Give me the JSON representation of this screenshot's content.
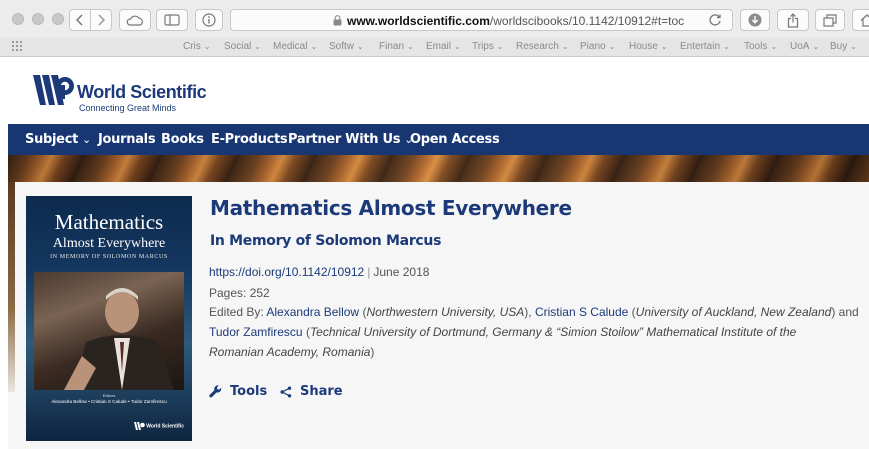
{
  "browser": {
    "url_domain": "www.worldscientific.com",
    "url_path": "/worldscibooks/10.1142/10912#t=toc",
    "favorites": [
      {
        "label": "Cris"
      },
      {
        "label": "Social"
      },
      {
        "label": "Medical"
      },
      {
        "label": "Softw"
      },
      {
        "label": "Finan"
      },
      {
        "label": "Email"
      },
      {
        "label": "Trips"
      },
      {
        "label": "Research"
      },
      {
        "label": "Piano"
      },
      {
        "label": "House"
      },
      {
        "label": "Entertain"
      },
      {
        "label": "Tools"
      },
      {
        "label": "UoA"
      },
      {
        "label": "Buy"
      }
    ],
    "favorites_chevron": "⌄"
  },
  "site": {
    "logo_title": "World Scientific",
    "logo_tagline": "Connecting Great Minds",
    "brand_color": "#1c3a7a",
    "nav": [
      {
        "label": "Subject",
        "has_dropdown": true
      },
      {
        "label": "Journals"
      },
      {
        "label": "Books"
      },
      {
        "label": "E-Products"
      },
      {
        "label": "Partner With Us",
        "has_dropdown": true
      },
      {
        "label": "Open Access"
      }
    ],
    "nav_chevron": "⌄"
  },
  "book": {
    "cover": {
      "title_line1": "Mathematics",
      "title_line2": "Almost Everywhere",
      "subtitle": "In Memory of Solomon Marcus",
      "editors_label": "Editors",
      "editors": "Alexandra Bellow • Cristian S Calude • Tudor Zamfirescu",
      "publisher": "World Scientific"
    },
    "title": "Mathematics Almost Everywhere",
    "subtitle": "In Memory of Solomon Marcus",
    "doi": "https://doi.org/10.1142/10912",
    "date": "June 2018",
    "separator": "|",
    "pages": "Pages: 252",
    "edited_by_label": "Edited By:",
    "editor1_name": "Alexandra Bellow",
    "editor1_aff": "Northwestern University, USA",
    "editor2_name": "Cristian S Calude",
    "editor2_aff": "University of Auckland, New Zealand",
    "and_text": "and",
    "editor3_name": "Tudor Zamfirescu",
    "editor3_aff_line1": "Technical University of Dortmund, Germany & “Simion Stoilow” Mathematical Institute of the",
    "editor3_aff_line2": "Romanian Academy, Romania",
    "paren_open": "(",
    "paren_close": ")",
    "paren_close_comma": "),",
    "actions": {
      "tools": "Tools",
      "share": "Share"
    }
  }
}
